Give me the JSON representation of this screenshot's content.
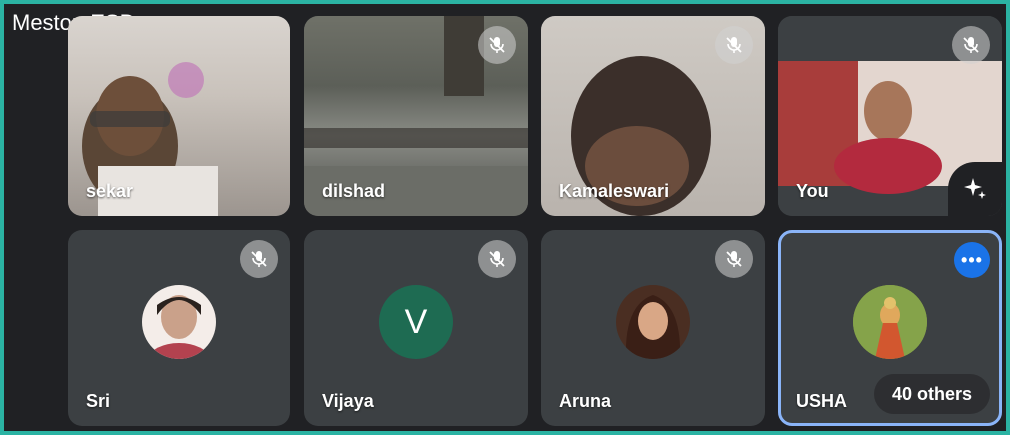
{
  "meeting": {
    "title": "Meston ESD",
    "chevron": "▸"
  },
  "participants": [
    {
      "name": "sekar",
      "muted": false
    },
    {
      "name": "dilshad",
      "muted": true
    },
    {
      "name": "Kamaleswari",
      "muted": true
    },
    {
      "name": "You",
      "muted": true
    },
    {
      "name": "Sri",
      "muted": true
    },
    {
      "name": "Vijaya",
      "muted": true,
      "avatar_letter": "V"
    },
    {
      "name": "Aruna",
      "muted": true
    },
    {
      "name": "USHA",
      "muted": false,
      "selected": true
    }
  ],
  "overflow": {
    "label": "40 others",
    "more_label": "•••"
  },
  "colors": {
    "accent": "#1a73e8",
    "selection": "#8ab4f8",
    "tile_bg": "#3c4043",
    "background": "#202124"
  },
  "icons": {
    "muted": "mic-off-icon",
    "effects": "sparkle-icon",
    "more": "more-horiz-icon"
  }
}
